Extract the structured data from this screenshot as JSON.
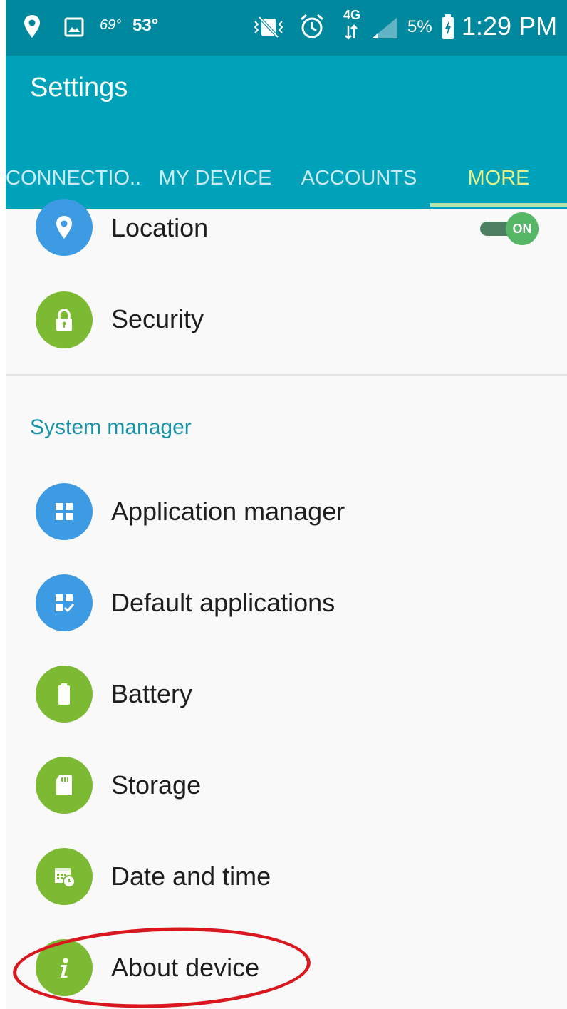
{
  "status_bar": {
    "temp_small": "69°",
    "temp": "53°",
    "network": "4G",
    "battery": "5%",
    "time": "1:29 PM"
  },
  "app_bar": {
    "title": "Settings",
    "tabs": [
      {
        "label": "CONNECTIO.."
      },
      {
        "label": "MY DEVICE"
      },
      {
        "label": "ACCOUNTS"
      },
      {
        "label": "MORE",
        "active": true
      }
    ]
  },
  "list": {
    "location": {
      "label": "Location",
      "toggle": "ON",
      "icon": "location-pin-icon"
    },
    "security": {
      "label": "Security",
      "icon": "lock-icon"
    },
    "section_header": "System manager",
    "items": [
      {
        "label": "Application manager",
        "icon": "app-grid-icon"
      },
      {
        "label": "Default applications",
        "icon": "default-apps-icon"
      },
      {
        "label": "Battery",
        "icon": "battery-icon"
      },
      {
        "label": "Storage",
        "icon": "sd-card-icon"
      },
      {
        "label": "Date and time",
        "icon": "calendar-clock-icon"
      },
      {
        "label": "About device",
        "icon": "info-icon"
      }
    ]
  },
  "colors": {
    "status_bar": "#00889e",
    "app_bar": "#00a2ba",
    "active_tab": "#e8f08a",
    "section_header": "#1792a6",
    "blue_icon": "#3d9be3",
    "green_icon": "#7dba34",
    "highlight": "#d8181e"
  }
}
